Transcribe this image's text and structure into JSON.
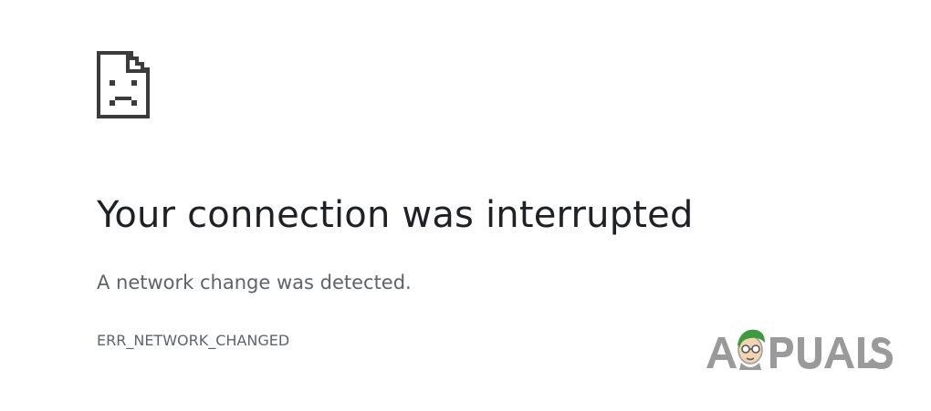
{
  "page": {
    "title": "Your connection was interrupted",
    "description": "A network change was detected.",
    "error_code": "ERR_NETWORK_CHANGED"
  },
  "icon": {
    "name": "sad-page-icon"
  },
  "watermark": {
    "text": "APPUALS",
    "icon": "appuals-mascot-icon",
    "color": "#9a9a9a"
  },
  "colors": {
    "title": "#202124",
    "secondary_text": "#5f6368",
    "icon": "#4a4a4a",
    "mascot_hair": "#3c9b3c",
    "background": "#ffffff"
  }
}
